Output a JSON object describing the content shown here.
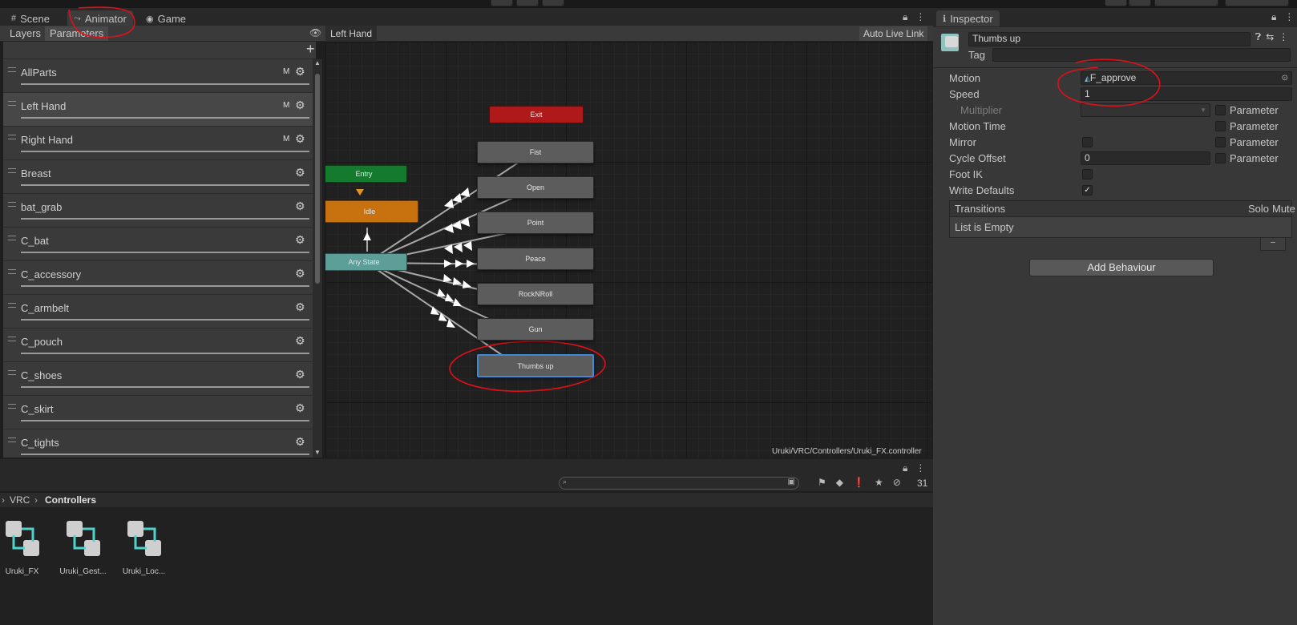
{
  "scene_tabs": {
    "scene": "Scene",
    "animator": "Animator",
    "game": "Game"
  },
  "animator": {
    "subtabs": {
      "layers": "Layers",
      "parameters": "Parameters"
    },
    "breadcrumb": "Left Hand",
    "auto_live_link": "Auto Live Link",
    "controller_path": "Uruki/VRC/Controllers/Uruki_FX.controller",
    "parameters": [
      {
        "name": "AllParts",
        "m": "M"
      },
      {
        "name": "Left Hand",
        "m": "M"
      },
      {
        "name": "Right Hand",
        "m": "M"
      },
      {
        "name": "Breast",
        "m": ""
      },
      {
        "name": "bat_grab",
        "m": ""
      },
      {
        "name": "C_bat",
        "m": ""
      },
      {
        "name": "C_accessory",
        "m": ""
      },
      {
        "name": "C_armbelt",
        "m": ""
      },
      {
        "name": "C_pouch",
        "m": ""
      },
      {
        "name": "C_shoes",
        "m": ""
      },
      {
        "name": "C_skirt",
        "m": ""
      },
      {
        "name": "C_tights",
        "m": ""
      }
    ],
    "states": {
      "exit": "Exit",
      "entry": "Entry",
      "idle": "Idle",
      "any_state": "Any State",
      "fist": "Fist",
      "open": "Open",
      "point": "Point",
      "peace": "Peace",
      "rocknroll": "RockNRoll",
      "gun": "Gun",
      "thumbs_up": "Thumbs up"
    },
    "colors": {
      "exit": "#b01919",
      "entry": "#137a2e",
      "idle": "#c8720f",
      "any_state": "#5d9e98",
      "selected_outline": "#3e8ad6",
      "annotation": "#e0101a"
    }
  },
  "project": {
    "breadcrumb": {
      "root": "VRC",
      "current": "Controllers"
    },
    "hidden_count": "31",
    "assets": [
      "Uruki_FX",
      "Uruki_Gest...",
      "Uruki_Loc..."
    ]
  },
  "inspector": {
    "tab": "Inspector",
    "state_name": "Thumbs up",
    "tag_label": "Tag",
    "rows": {
      "motion": "Motion",
      "motion_value": "F_approve",
      "speed": "Speed",
      "speed_value": "1",
      "multiplier": "Multiplier",
      "motion_time": "Motion Time",
      "mirror": "Mirror",
      "cycle_offset": "Cycle Offset",
      "cycle_offset_value": "0",
      "foot_ik": "Foot IK",
      "write_defaults": "Write Defaults"
    },
    "parameter_label": "Parameter",
    "transitions": {
      "title": "Transitions",
      "solo": "Solo",
      "mute": "Mute",
      "empty": "List is Empty"
    },
    "add_behaviour": "Add Behaviour"
  }
}
